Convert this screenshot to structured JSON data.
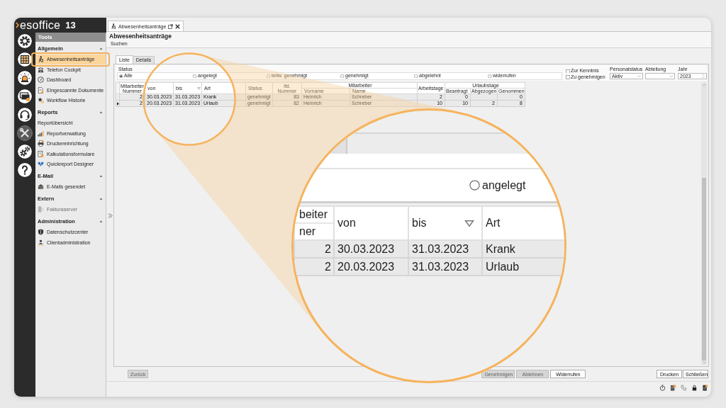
{
  "app": {
    "logo": "esoffice",
    "version": "13"
  },
  "icon_bar": [
    {
      "selected": false
    },
    {
      "selected": false
    },
    {
      "selected": false
    },
    {
      "selected": false
    },
    {
      "selected": false
    },
    {
      "selected": true
    },
    {
      "selected": false
    },
    {
      "selected": false
    }
  ],
  "sidebar": {
    "title": "Tools",
    "sections": [
      {
        "title": "Allgemein",
        "expanded": true,
        "items": [
          {
            "label": "Abwesenheitsanträge",
            "kind": "icon",
            "selected": true,
            "disabled": false
          },
          {
            "label": "Telefon Cockpit",
            "kind": "icon",
            "selected": false,
            "disabled": false
          },
          {
            "label": "Dashboard",
            "kind": "icon",
            "selected": false,
            "disabled": false
          },
          {
            "label": "Eingescannte Dokumente",
            "kind": "icon",
            "selected": false,
            "disabled": false
          },
          {
            "label": "Workflow Historie",
            "kind": "icon",
            "selected": false,
            "disabled": false
          }
        ]
      },
      {
        "title": "Reports",
        "expanded": true,
        "items": [
          {
            "label": "Reportübersicht",
            "kind": "plain",
            "selected": false,
            "disabled": false
          },
          {
            "label": "Reportverwaltung",
            "kind": "icon",
            "selected": false,
            "disabled": false
          },
          {
            "label": "Druckereinrichtung",
            "kind": "icon",
            "selected": false,
            "disabled": false
          },
          {
            "label": "Kalkulationsformulare",
            "kind": "icon",
            "selected": false,
            "disabled": false
          },
          {
            "label": "Quickreport Designer",
            "kind": "icon",
            "selected": false,
            "disabled": false
          }
        ]
      },
      {
        "title": "E-Mail",
        "expanded": true,
        "items": [
          {
            "label": "E-Mails gesendet",
            "kind": "icon",
            "selected": false,
            "disabled": false
          }
        ]
      },
      {
        "title": "Extern",
        "expanded": true,
        "items": [
          {
            "label": "Fakturaserver",
            "kind": "icon",
            "selected": false,
            "disabled": true
          }
        ]
      },
      {
        "title": "Administration",
        "expanded": true,
        "items": [
          {
            "label": "Datenschutzcenter",
            "kind": "icon",
            "selected": false,
            "disabled": false
          },
          {
            "label": "Clientadministration",
            "kind": "icon",
            "selected": false,
            "disabled": false
          }
        ]
      }
    ]
  },
  "document_tab": {
    "label": "Abwesenheitsanträge"
  },
  "page": {
    "title": "Abwesenheitsanträge",
    "menu": [
      "Suchen"
    ]
  },
  "view_tabs": [
    {
      "label": "Liste",
      "selected": true
    },
    {
      "label": "Details",
      "selected": false
    }
  ],
  "filters": {
    "status": {
      "label": "Status",
      "options": [
        {
          "label": "Alle",
          "selected": true
        },
        {
          "label": "angelegt",
          "selected": false
        },
        {
          "label": "teilw. genehmigt",
          "selected": false
        },
        {
          "label": "genehmigt",
          "selected": false
        },
        {
          "label": "abgelehnt",
          "selected": false
        },
        {
          "label": "widerrufen",
          "selected": false
        }
      ]
    },
    "checkboxes": [
      {
        "label": "Zur Kenntnis",
        "checked": false
      },
      {
        "label": "Zu genehmigen",
        "checked": false
      }
    ],
    "dropdowns": [
      {
        "label": "Personalstatus",
        "value": "Aktiv"
      },
      {
        "label": "Abteilung"
      }
    ],
    "year": {
      "label": "Jahr",
      "value": "2023"
    }
  },
  "table": {
    "columns": [
      {
        "label": "Mitarbeiter Nummer",
        "kind": "number",
        "filtered": false
      },
      {
        "label": "von",
        "kind": "text",
        "filtered": false
      },
      {
        "label": "bis",
        "kind": "text",
        "filtered": true
      },
      {
        "label": "Art",
        "kind": "text",
        "filtered": false
      },
      {
        "label": "Status",
        "kind": "text",
        "filtered": false
      },
      {
        "label": "lfd. Nummer",
        "kind": "number",
        "filtered": false
      },
      {
        "label": "Mitarbeiter",
        "colspan": 2,
        "children": [
          {
            "label": "Vorname",
            "kind": "text",
            "filtered": false
          },
          {
            "label": "Name",
            "kind": "text",
            "filtered": false
          }
        ]
      },
      {
        "label": "Arbeitstage",
        "kind": "number",
        "filtered": false
      },
      {
        "label": "Urlaubstage",
        "colspan": 3,
        "children": [
          {
            "label": "Beantragt",
            "kind": "number",
            "filtered": false
          },
          {
            "label": "Abgezogen",
            "kind": "number",
            "filtered": false
          },
          {
            "label": "Genommen",
            "kind": "number",
            "filtered": false
          }
        ]
      }
    ],
    "rows": [
      {
        "selected": false,
        "cells": [
          "2",
          "30.03.2023",
          "31.03.2023",
          "Krank",
          "genehmigt",
          "83",
          "Heinrich",
          "Schreber",
          "2",
          "0",
          null,
          "0"
        ]
      },
      {
        "selected": true,
        "cells": [
          "2",
          "20.03.2023",
          "31.03.2023",
          "Urlaub",
          "genehmigt",
          "82",
          "Heinrich",
          "Schreber",
          "10",
          "10",
          "2",
          "8"
        ]
      }
    ]
  },
  "buttons": {
    "left": [
      {
        "label": "Zurück",
        "disabled": true
      }
    ],
    "center": [
      {
        "label": "Genehmigen",
        "disabled": true
      },
      {
        "label": "Ablehnen",
        "disabled": true
      },
      {
        "label": "Widerrufen",
        "disabled": false
      }
    ],
    "right": [
      {
        "label": "Drucken",
        "disabled": false
      },
      {
        "label": "Schließen",
        "disabled": false
      }
    ]
  },
  "magnifier": {
    "status_option": {
      "label": "angelegt",
      "selected": false
    },
    "columns": [
      {
        "lines": [
          "beiter",
          "ner"
        ],
        "kind": "number",
        "filtered": false
      },
      {
        "lines": [
          "von"
        ],
        "kind": "text",
        "filtered": false
      },
      {
        "lines": [
          "bis"
        ],
        "kind": "text",
        "filtered": true
      },
      {
        "lines": [
          "Art"
        ],
        "kind": "text",
        "filtered": false
      }
    ],
    "rows": [
      {
        "cells": [
          "2",
          "30.03.2023",
          "31.03.2023",
          "Krank"
        ]
      },
      {
        "cells": [
          "2",
          "20.03.2023",
          "31.03.2023",
          "Urlaub"
        ]
      }
    ]
  }
}
